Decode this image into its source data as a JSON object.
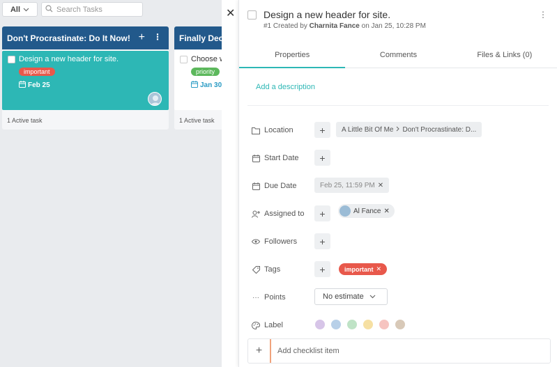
{
  "toolbar": {
    "filter_label": "All",
    "search_placeholder": "Search Tasks"
  },
  "columns": [
    {
      "title": "Don't Procrastinate: Do It Now!",
      "card": {
        "title": "Design a new header for site.",
        "tag": "important",
        "date": "Feb 25"
      },
      "footer": "1 Active task"
    },
    {
      "title": "Finally Decided t",
      "card": {
        "title": "Choose winn",
        "tag": "priority",
        "date": "Jan 30"
      },
      "footer": "1 Active task"
    }
  ],
  "task": {
    "title": "Design a new header for site.",
    "meta_prefix": "#1 Created by",
    "meta_author": "Charnita Fance",
    "meta_suffix": "on Jan 25, 10:28 PM"
  },
  "tabs": [
    "Properties",
    "Comments",
    "Files & Links (0)"
  ],
  "description_placeholder": "Add a description",
  "properties": {
    "location_label": "Location",
    "location_value_1": "A Little Bit Of Me",
    "location_value_2": "Don't Procrastinate: D...",
    "start_label": "Start Date",
    "due_label": "Due Date",
    "due_value": "Feb 25, 11:59 PM",
    "assigned_label": "Assigned to",
    "assignee": "Al Fance",
    "followers_label": "Followers",
    "tags_label": "Tags",
    "tag": "important",
    "points_label": "Points",
    "points_value": "No estimate",
    "label_label": "Label"
  },
  "label_colors": [
    "#d7c5e8",
    "#b8d0e8",
    "#bfe3c6",
    "#f6e0a3",
    "#f6c4c0",
    "#d8c9b8"
  ],
  "checklist_placeholder": "Add checklist item"
}
